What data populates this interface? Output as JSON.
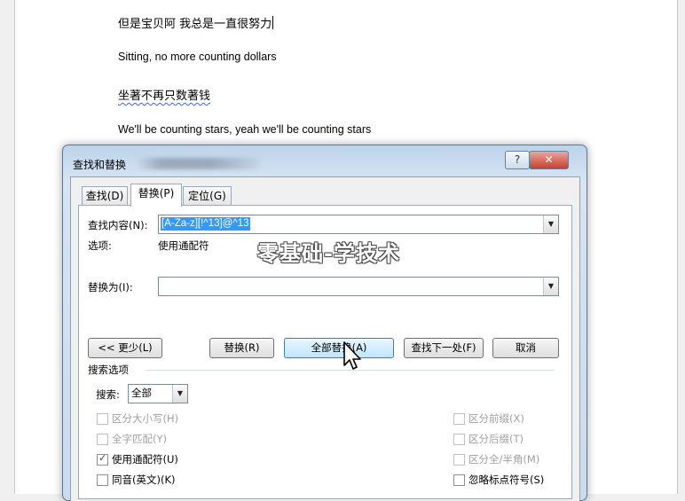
{
  "document": {
    "lines": [
      "但是宝贝阿 我总是一直很努力",
      "Sitting, no more counting dollars",
      "坐著不再只数著钱",
      "We'll be counting stars, yeah we'll be counting stars"
    ]
  },
  "dialog": {
    "title": "查找和替换",
    "help_label": "?",
    "close_label": "✕",
    "tabs": [
      "查找(D)",
      "替换(P)",
      "定位(G)"
    ],
    "find": {
      "label": "查找内容(N):",
      "value": "[A-Za-z][!^13]@^13"
    },
    "options_label": "选项:",
    "options_value": "使用通配符",
    "replace": {
      "label": "替换为(I):",
      "value": ""
    },
    "buttons": {
      "less": "<< 更少(L)",
      "replace": "替换(R)",
      "replace_all": "全部替换(A)",
      "find_next": "查找下一处(F)",
      "cancel": "取消"
    },
    "search_options_title": "搜索选项",
    "search_label": "搜索:",
    "search_value": "全部",
    "checkboxes_left": [
      {
        "label": "区分大小写(H)",
        "checked": false,
        "enabled": false
      },
      {
        "label": "全字匹配(Y)",
        "checked": false,
        "enabled": false
      },
      {
        "label": "使用通配符(U)",
        "checked": true,
        "enabled": true
      },
      {
        "label": "同音(英文)(K)",
        "checked": false,
        "enabled": true
      }
    ],
    "checkboxes_right": [
      {
        "label": "区分前缀(X)",
        "checked": false,
        "enabled": false
      },
      {
        "label": "区分后缀(T)",
        "checked": false,
        "enabled": false
      },
      {
        "label": "区分全/半角(M)",
        "checked": false,
        "enabled": false
      },
      {
        "label": "忽略标点符号(S)",
        "checked": false,
        "enabled": true
      }
    ]
  },
  "watermark": "零基础-学技术",
  "icons": {
    "dropdown": "chevron-down-icon",
    "check": "checkmark-icon",
    "cursor": "mouse-pointer-icon"
  }
}
